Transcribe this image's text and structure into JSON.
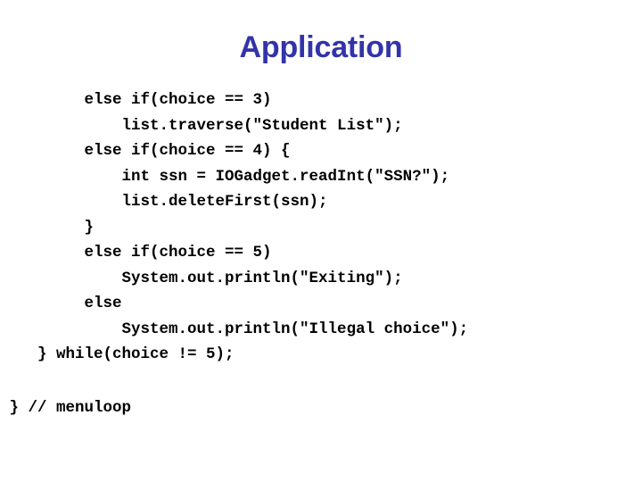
{
  "slide": {
    "title": "Application",
    "title_color": "#3333aa",
    "background_color": "#ffffff",
    "text_color": "#000000"
  },
  "code": {
    "language": "java",
    "lines": [
      "         else if(choice == 3)",
      "             list.traverse(\"Student List\");",
      "         else if(choice == 4) {",
      "             int ssn = IOGadget.readInt(\"SSN?\");",
      "             list.deleteFirst(ssn);",
      "         }",
      "         else if(choice == 5)",
      "             System.out.println(\"Exiting\");",
      "         else",
      "             System.out.println(\"Illegal choice\");",
      "    } while(choice != 5);"
    ]
  },
  "trailing": {
    "lines": [
      " } // menuloop"
    ]
  }
}
